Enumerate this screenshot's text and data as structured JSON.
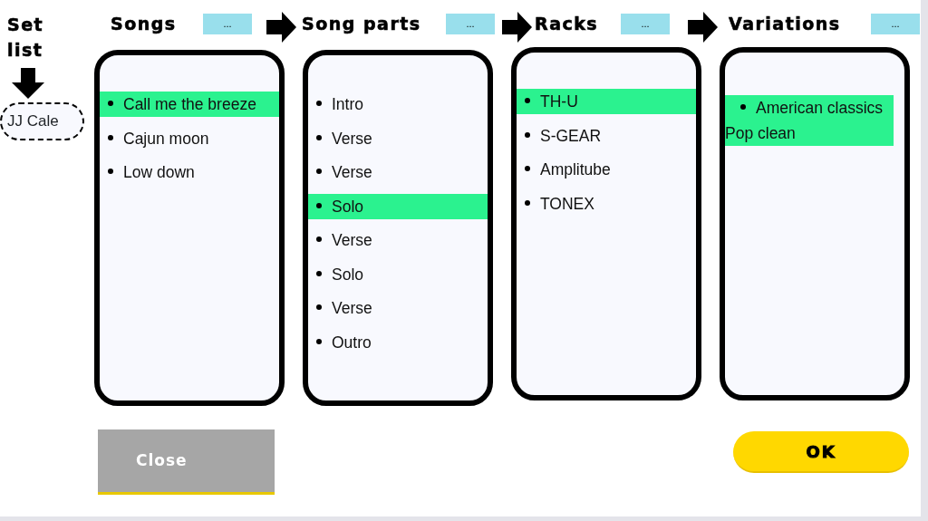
{
  "set_list": {
    "title": "Set list",
    "artist": "JJ Cale"
  },
  "columns": [
    {
      "title": "Songs",
      "button": "...",
      "items": [
        {
          "text": "Call me the breeze",
          "selected": true
        },
        {
          "text": "Cajun moon",
          "selected": false
        },
        {
          "text": "Low down",
          "selected": false
        }
      ]
    },
    {
      "title": "Song parts",
      "button": "...",
      "items": [
        {
          "text": "Intro",
          "selected": false
        },
        {
          "text": "Verse",
          "selected": false
        },
        {
          "text": "Verse",
          "selected": false
        },
        {
          "text": "Solo",
          "selected": true
        },
        {
          "text": "Verse",
          "selected": false
        },
        {
          "text": "Solo",
          "selected": false
        },
        {
          "text": "Verse",
          "selected": false
        },
        {
          "text": "Outro",
          "selected": false
        }
      ]
    },
    {
      "title": "Racks",
      "button": "...",
      "items": [
        {
          "text": "TH-U",
          "selected": true
        },
        {
          "text": "S-GEAR",
          "selected": false
        },
        {
          "text": "Amplitube",
          "selected": false
        },
        {
          "text": "TONEX",
          "selected": false
        }
      ]
    },
    {
      "title": "Variations",
      "button": "...",
      "items": [
        {
          "text": "American classics Pop clean",
          "selected": true
        }
      ]
    }
  ],
  "buttons": {
    "close": "Close",
    "ok": "OK"
  }
}
